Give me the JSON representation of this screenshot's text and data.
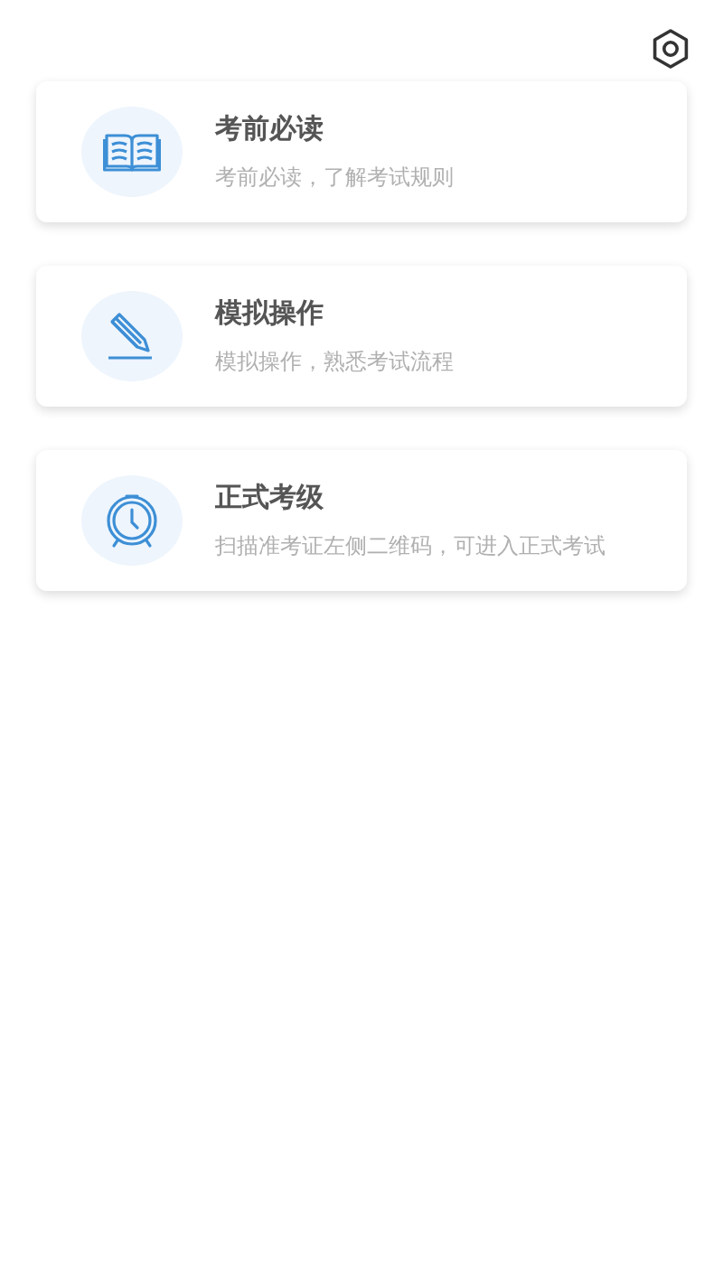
{
  "cards": [
    {
      "kind": "book",
      "title": "考前必读",
      "subtitle": "考前必读，了解考试规则"
    },
    {
      "kind": "pencil",
      "title": "模拟操作",
      "subtitle": "模拟操作，熟悉考试流程"
    },
    {
      "kind": "clock",
      "title": "正式考级",
      "subtitle": "扫描准考证左侧二维码，可进入正式考试"
    }
  ]
}
